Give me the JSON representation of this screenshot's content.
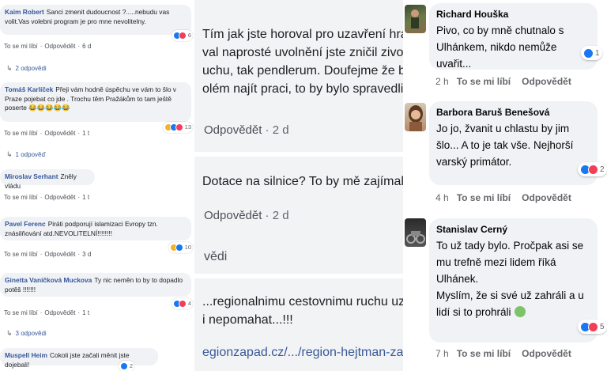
{
  "left_column": {
    "comments": [
      {
        "author": "Kaim Robert",
        "text": "Sanci zmenit dudoucnost ?.....nebudu vas volit.Vas volebni program je pro mne nevolitelny.",
        "like": "To se mi líbí",
        "reply": "Odpovědět",
        "time": "6 d",
        "reactions": "6"
      },
      {
        "author": "Tomáš Karlíček",
        "text": "Přeji vám hodně úspěchu ve vám to šlo v Praze pojebat co jde . Trochu těm Pražákům to tam ještě poserte 😂😂😂😂😂",
        "like": "To se mi líbí",
        "reply": "Odpovědět",
        "time": "1 t",
        "reactions": "13"
      },
      {
        "author": "Miroslav Serhant",
        "text": "Zněly vládu",
        "like": "To se mi líbí",
        "reply": "Odpovědět",
        "time": "1 t",
        "reactions": ""
      },
      {
        "author": "Pavel Ferenc",
        "text": "Piráti podporují islamizaci Evropy tzn. znásilňování atd.NEVOLITELNÍ!!!!!!!!",
        "like": "To se mi líbí",
        "reply": "Odpovědět",
        "time": "3 d",
        "reactions": "10"
      },
      {
        "author": "Ginetta Vaničková Muckova",
        "text": "Ty nic neměn to by to dopadlo potěš !!!!!!!",
        "like": "To se mi líbí",
        "reply": "Odpovědět",
        "time": "1 t",
        "reactions": "4"
      },
      {
        "author": "Muspell Heim",
        "text": "Cokoli jste začali měnit jste dojebali!",
        "like": "",
        "reply": "",
        "time": "",
        "reactions": "2"
      }
    ],
    "replies_1": "2 odpovědi",
    "replies_2": "1 odpověď",
    "replies_3": "3 odpovědi"
  },
  "middle_column": {
    "block1_lines": [
      "Tím jak jste horoval pro uzavření hranic",
      "val naprosté uvolnění jste zničil zivot ja",
      "uchu, tak pendlerum. Doufejme že bude",
      "olém najít praci, to by bylo spravedlivé..."
    ],
    "actions1_reply": "Odpovědět",
    "actions1_time": "2 d",
    "block2_text": "Dotace na silnice? To by mě zajímalo k",
    "actions2_reply": "Odpovědět",
    "actions2_time": "2 d",
    "partial_label": "vědi",
    "block3_lines": [
      "...regionalnimu cestovnimu ruchu uz js",
      "i nepomahat...!!!"
    ],
    "link_text": "egionzapad.cz/.../region-hejtman-zada"
  },
  "right_column": {
    "comments": [
      {
        "author": "Richard Houška",
        "text": "Pivo, co by mně chutnalo s\nUlhánkem, nikdo nemůže uvařit...",
        "time": "2 h",
        "like": "To se mi líbí",
        "reply": "Odpovědět",
        "reactions": "1"
      },
      {
        "author": "Barbora Baruš Benešová",
        "text": "Jo jo, žvanit u chlastu by jim\nšlo... A to je tak vše. Nejhorší\nvarský primátor.",
        "time": "4 h",
        "like": "To se mi líbí",
        "reply": "Odpovědět",
        "reactions": "2"
      },
      {
        "author": "Stanislav Cerný",
        "text": "To už tady bylo. Pročpak asi se\nmu trefně mezi lidem říká\nUlhánek.\nMyslím, že si své už zahráli a u\nlidí si to prohráli",
        "time": "7 h",
        "like": "To se mi líbí",
        "reply": "Odpovědět",
        "reactions": "5"
      }
    ]
  },
  "colors": {
    "name_link": "#365899",
    "bubble_bg": "#f0f2f5",
    "like_blue": "#1877f2",
    "love_red": "#f33e58",
    "haha_yellow": "#f7b125"
  }
}
